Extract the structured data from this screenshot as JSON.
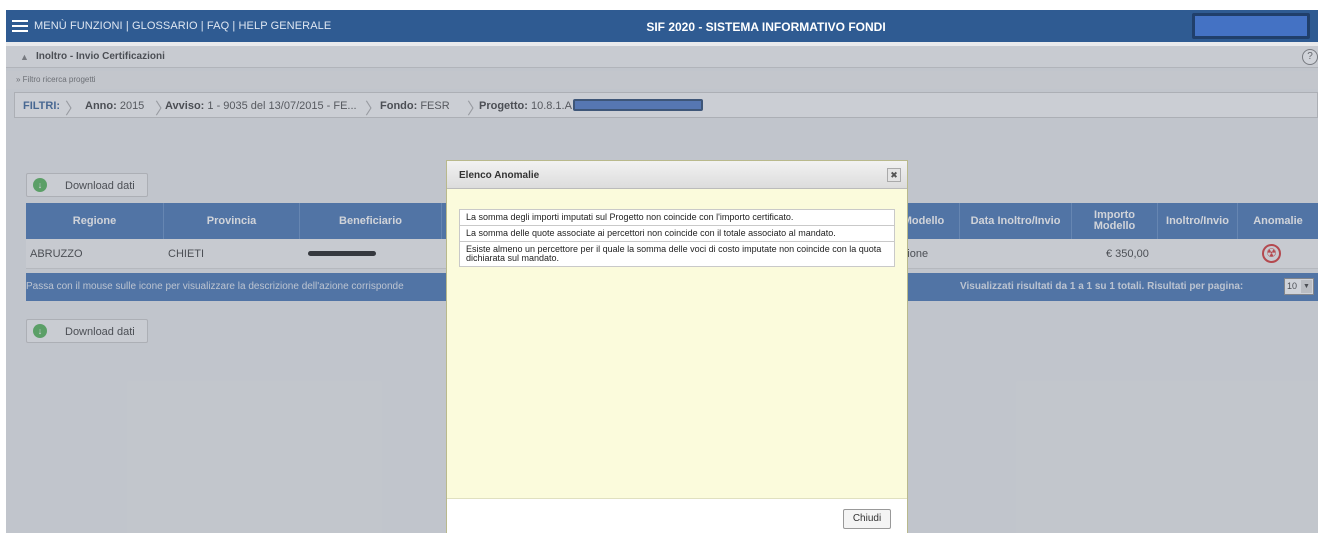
{
  "topbar": {
    "nav_text": "MENÙ FUNZIONI | GLOSSARIO | FAQ | HELP GENERALE",
    "app_title": "SIF 2020 - SISTEMA INFORMATIVO FONDI"
  },
  "breadcrumb": {
    "page": "Inoltro - Invio Certificazioni"
  },
  "filter_link": "» Filtro ricerca progetti",
  "filters": {
    "label": "FILTRI:",
    "anno_key": "Anno:",
    "anno_val": "2015",
    "avviso_key": "Avviso:",
    "avviso_val": "1 - 9035 del 13/07/2015 - FE...",
    "fondo_key": "Fondo:",
    "fondo_val": "FESR",
    "progetto_key": "Progetto:",
    "progetto_val": "10.8.1.A"
  },
  "download_label": "Download dati",
  "table": {
    "headers": {
      "regione": "Regione",
      "provincia": "Provincia",
      "beneficiario": "Beneficiario",
      "modello": "Modello",
      "data_inoltro": "Data Inoltro/Invio",
      "importo": "Importo Modello",
      "inoltro": "Inoltro/Invio",
      "anomalie": "Anomalie"
    },
    "row": {
      "regione": "ABRUZZO",
      "provincia": "CHIETI",
      "modello": "razione",
      "importo": "€ 350,00"
    },
    "footer_hint": "Passa con il mouse sulle icone per visualizzare la descrizione dell'azione corrisponde",
    "pager_text": "Visualizzati risultati da 1 a 1 su 1 totali. Risultati per pagina:",
    "per_page": "10"
  },
  "modal": {
    "title": "Elenco Anomalie",
    "items": [
      "La somma degli importi imputati sul Progetto non coincide con l'importo certificato.",
      "La somma delle quote associate ai percettori non coincide con il totale associato al mandato.",
      "Esiste almeno un percettore per il quale la somma delle voci di costo imputate non coincide con la quota dichiarata sul mandato."
    ],
    "close_label": "Chiudi"
  }
}
